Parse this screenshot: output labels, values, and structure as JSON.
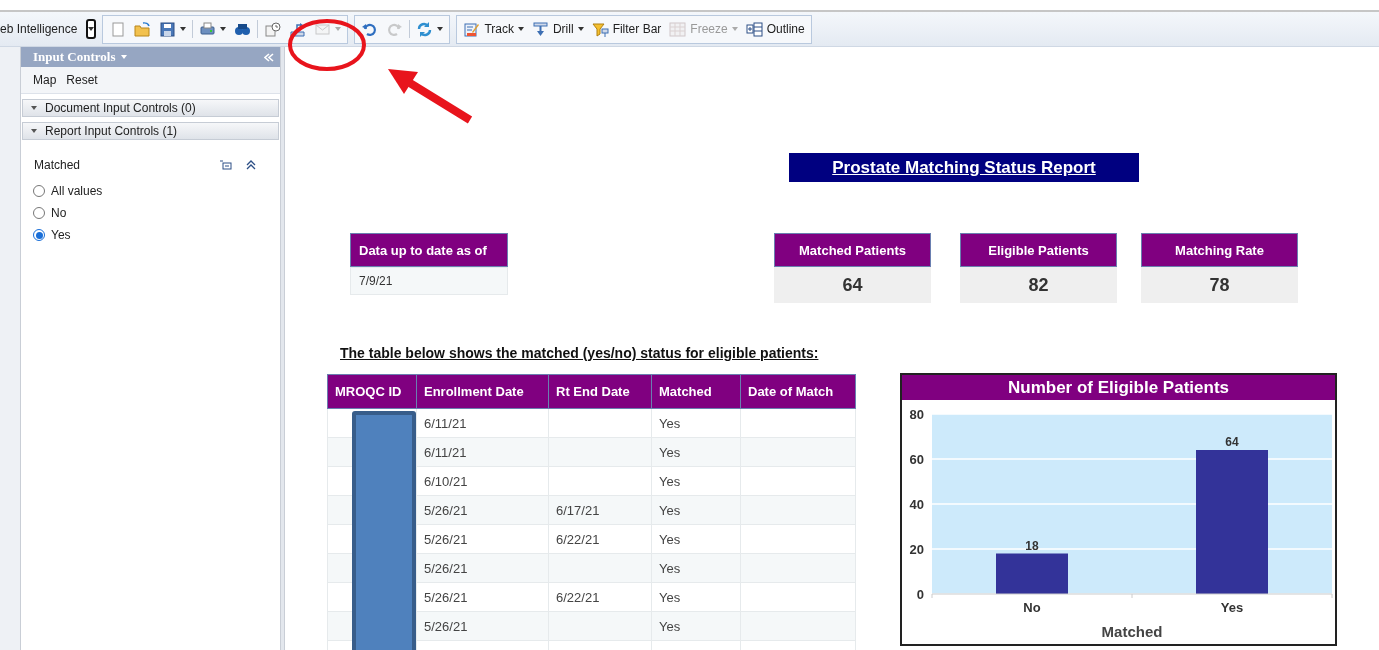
{
  "app": {
    "title": "eb Intelligence"
  },
  "toolbar": {
    "groups": [
      [
        {
          "kind": "new",
          "disabled": false,
          "menu": false
        },
        {
          "kind": "open",
          "disabled": false,
          "menu": false
        },
        {
          "kind": "save",
          "disabled": false,
          "menu": true
        },
        {
          "kind": "print",
          "disabled": false,
          "menu": true
        },
        {
          "kind": "find",
          "disabled": false,
          "menu": false
        },
        {
          "kind": "schedule",
          "disabled": false,
          "menu": false
        },
        {
          "kind": "publish",
          "disabled": false,
          "menu": false
        },
        {
          "kind": "email",
          "disabled": true,
          "menu": true
        }
      ],
      [
        {
          "kind": "undo",
          "disabled": false,
          "menu": false
        },
        {
          "kind": "redo",
          "disabled": true,
          "menu": false
        },
        {
          "kind": "refresh",
          "disabled": false,
          "menu": true
        }
      ],
      [
        {
          "kind": "track",
          "label": "Track",
          "disabled": false,
          "menu": true
        },
        {
          "kind": "drill",
          "label": "Drill",
          "disabled": false,
          "menu": true
        },
        {
          "kind": "filter",
          "label": "Filter Bar",
          "disabled": false,
          "menu": false
        },
        {
          "kind": "freeze",
          "label": "Freeze",
          "disabled": true,
          "menu": true
        },
        {
          "kind": "outline",
          "label": "Outline",
          "disabled": false,
          "menu": false
        }
      ]
    ]
  },
  "panel": {
    "title": "Input Controls",
    "actions": [
      "Map",
      "Reset"
    ],
    "sections": [
      {
        "label": "Document Input Controls (0)",
        "expanded": true
      },
      {
        "label": "Report Input Controls (1)",
        "expanded": true,
        "control": {
          "label": "Matched",
          "options": [
            {
              "label": "All values",
              "selected": false
            },
            {
              "label": "No",
              "selected": false
            },
            {
              "label": "Yes",
              "selected": true
            }
          ]
        }
      }
    ]
  },
  "report": {
    "title": "Prostate Matching Status Report",
    "date_block": {
      "header": "Data up to date as of",
      "value": "7/9/21"
    },
    "kpis": [
      {
        "header": "Matched Patients",
        "value": "64"
      },
      {
        "header": "Eligible Patients",
        "value": "82"
      },
      {
        "header": "Matching Rate",
        "value": "78"
      }
    ],
    "table": {
      "caption": "The table below shows the matched (yes/no) status for eligible patients:",
      "columns": [
        "MROQC ID",
        "Enrollment Date",
        "Rt End Date",
        "Matched",
        "Date of Match"
      ],
      "rows": [
        {
          "enrollment_date": "6/11/21",
          "matched": "Yes"
        },
        {
          "enrollment_date": "6/11/21",
          "matched": "Yes"
        },
        {
          "enrollment_date": "6/10/21",
          "matched": "Yes"
        },
        {
          "enrollment_date": "5/26/21",
          "rt_end_date": "6/17/21",
          "matched": "Yes"
        },
        {
          "enrollment_date": "5/26/21",
          "rt_end_date": "6/22/21",
          "matched": "Yes"
        },
        {
          "enrollment_date": "5/26/21",
          "matched": "Yes"
        },
        {
          "enrollment_date": "5/26/21",
          "rt_end_date": "6/22/21",
          "matched": "Yes"
        },
        {
          "enrollment_date": "5/26/21",
          "matched": "Yes"
        }
      ]
    },
    "chart": {
      "chart_data": {
        "type": "bar",
        "title": "Number of Eligible Patients",
        "xlabel": "Matched",
        "categories": [
          "No",
          "Yes"
        ],
        "series": [
          {
            "color": "#333399",
            "values": [
              18,
              64
            ]
          }
        ],
        "grid": true,
        "ylim": [
          0,
          80
        ],
        "yticks": [
          0,
          20,
          40,
          60,
          80
        ],
        "data_labels": true
      }
    }
  }
}
